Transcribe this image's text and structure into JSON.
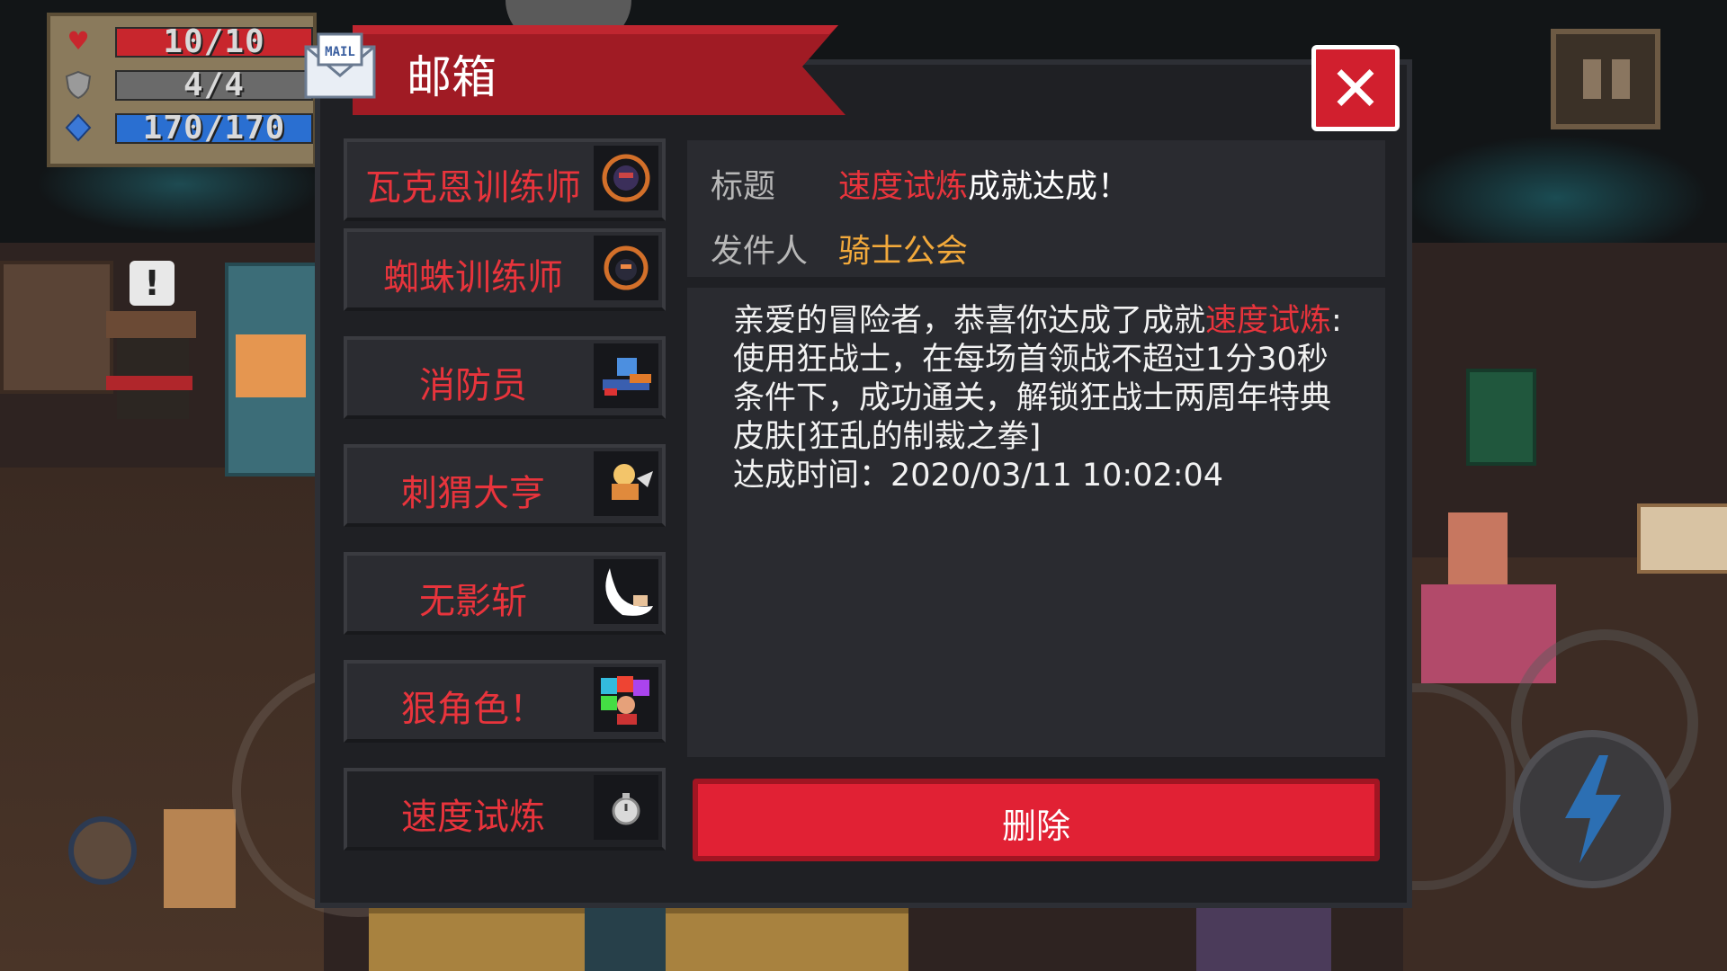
{
  "hud": {
    "health": "10/10",
    "health_fraction": 1.0,
    "armor": "4/4",
    "armor_fraction": 1.0,
    "energy": "170/170",
    "energy_fraction": 1.0
  },
  "icons": {
    "health": "heart-icon",
    "armor": "shield-icon",
    "energy": "diamond-icon",
    "mail": "mail-envelope-icon",
    "close": "close-icon",
    "pause": "pause-icon",
    "skill": "lightning-icon"
  },
  "mailbox": {
    "title": "邮箱",
    "envelope_text": "MAIL",
    "close_label": "✕",
    "items": [
      {
        "label": "瓦克恩训练师",
        "icon": "wizard-trainer-icon"
      },
      {
        "label": "蜘蛛训练师",
        "icon": "spider-trainer-icon"
      },
      {
        "label": "消防员",
        "icon": "firefighter-icon"
      },
      {
        "label": "刺猬大亨",
        "icon": "hedgehog-tycoon-icon"
      },
      {
        "label": "无影斩",
        "icon": "crescent-slash-icon"
      },
      {
        "label": "狠角色！",
        "icon": "tough-guy-icon"
      },
      {
        "label": "速度试炼",
        "icon": "stopwatch-icon"
      }
    ],
    "selected_index": 6,
    "detail": {
      "subject_label": "标题",
      "subject_highlight": "速度试炼",
      "subject_rest": "成就达成！",
      "sender_label": "发件人",
      "sender": "骑士公会",
      "body_prefix": "亲爱的冒险者，恭喜你达成了成就",
      "body_highlight": "速度试炼",
      "body_rest": ":使用狂战士，在每场首领战不超过1分30秒条件下，成功通关，解锁狂战士两周年特典皮肤[狂乱的制裁之拳]",
      "achieved_label": "达成时间：",
      "achieved_time": "2020/03/11 10:02:04"
    },
    "delete_label": "删除"
  },
  "colors": {
    "accent_red": "#e8343c",
    "sender_gold": "#f2a93b",
    "panel_bg": "#1f2024",
    "delete_btn": "#e12134",
    "health_bar": "#c8262d",
    "armor_bar": "#6a6a6a",
    "energy_bar": "#2a6fd1"
  }
}
